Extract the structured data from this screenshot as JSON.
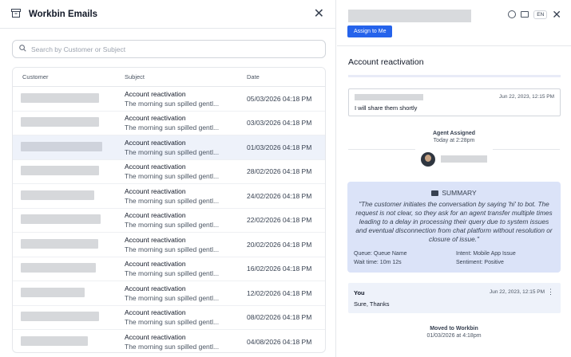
{
  "left_panel": {
    "title": "Workbin Emails",
    "search_placeholder": "Search by Customer or Subject",
    "columns": [
      "Customer",
      "Subject",
      "Date"
    ],
    "rows": [
      {
        "subject": "Account reactivation",
        "preview": "The morning sun spilled gentl...",
        "date": "05/03/2026 04:18 PM",
        "selected": false
      },
      {
        "subject": "Account reactivation",
        "preview": "The morning sun spilled gentl...",
        "date": "03/03/2026 04:18 PM",
        "selected": false
      },
      {
        "subject": "Account reactivation",
        "preview": "The morning sun spilled gentl...",
        "date": "01/03/2026 04:18 PM",
        "selected": true
      },
      {
        "subject": "Account reactivation",
        "preview": "The morning sun spilled gentl...",
        "date": "28/02/2026 04:18 PM",
        "selected": false
      },
      {
        "subject": "Account reactivation",
        "preview": "The morning sun spilled gentl...",
        "date": "24/02/2026 04:18 PM",
        "selected": false
      },
      {
        "subject": "Account reactivation",
        "preview": "The morning sun spilled gentl...",
        "date": "22/02/2026 04:18 PM",
        "selected": false
      },
      {
        "subject": "Account reactivation",
        "preview": "The morning sun spilled gentl...",
        "date": "20/02/2026 04:18 PM",
        "selected": false
      },
      {
        "subject": "Account reactivation",
        "preview": "The morning sun spilled gentl...",
        "date": "16/02/2026 04:18 PM",
        "selected": false
      },
      {
        "subject": "Account reactivation",
        "preview": "The morning sun spilled gentl...",
        "date": "12/02/2026 04:18 PM",
        "selected": false
      },
      {
        "subject": "Account reactivation",
        "preview": "The morning sun spilled gentl...",
        "date": "08/02/2026 04:18 PM",
        "selected": false
      },
      {
        "subject": "Account reactivation",
        "preview": "The morning sun spilled gentl...",
        "date": "04/08/2026 04:18 PM",
        "selected": false
      }
    ]
  },
  "right_panel": {
    "assign_label": "Assign to Me",
    "lang": "EN",
    "title": "Account reactivation",
    "first_message": {
      "time": "Jun 22, 2023, 12:15 PM",
      "text": "I will share them shortly"
    },
    "agent_assigned": {
      "heading": "Agent Assigned",
      "time": "Today at 2:28pm"
    },
    "summary": {
      "heading": "SUMMARY",
      "text": "\"The customer initiates the conversation by saying 'hi' to bot. The request is not clear, so they ask for an agent transfer multiple times leading to a delay in processing their query due to system issues and eventual disconnection from chat platform without resolution or closure of issue.\"",
      "queue": "Queue:   Queue Name",
      "wait": "Wait time:   10m 12s",
      "intent": "Intent:   Mobile App Issue",
      "sentiment": "Sentiment:   Positive"
    },
    "you_message": {
      "name": "You",
      "time": "Jun 22, 2023, 12:15 PM",
      "text": "Sure, Thanks"
    },
    "moved": {
      "heading": "Moved to Workbin",
      "time": "01/03/2026 at 4:18pm"
    }
  },
  "icons": [
    "archive-icon",
    "close-icon",
    "search-icon",
    "check-circle-icon",
    "mail-icon",
    "more-vertical-icon",
    "document-icon"
  ]
}
